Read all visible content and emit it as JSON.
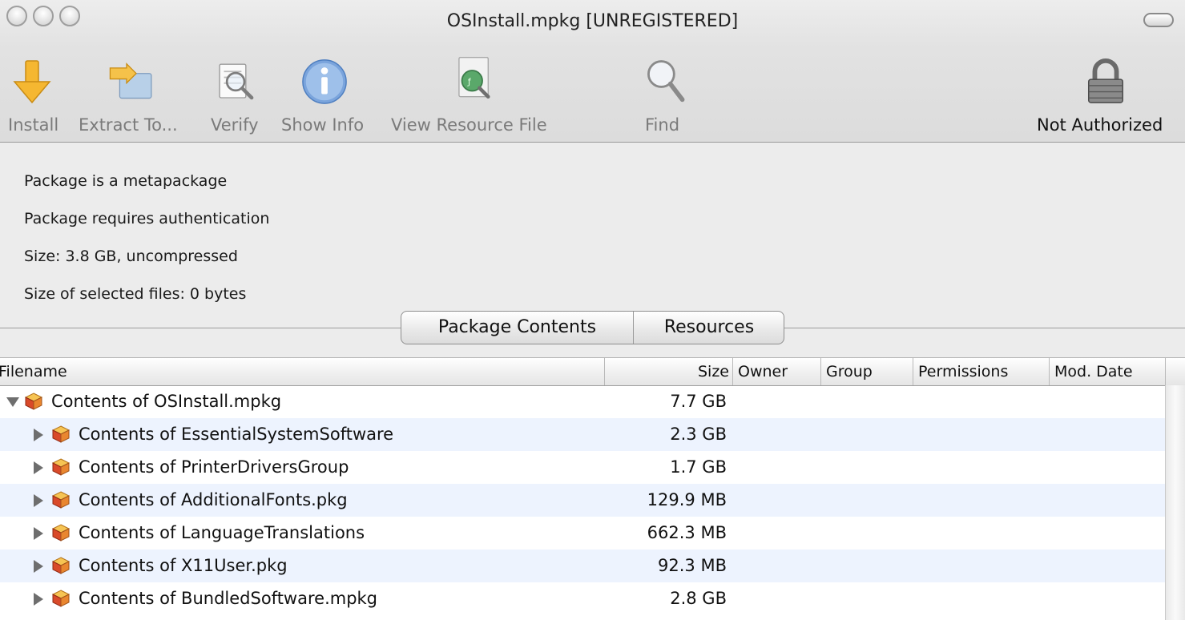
{
  "window": {
    "title": "OSInstall.mpkg [UNREGISTERED]"
  },
  "toolbar": {
    "install": "Install",
    "extract": "Extract To...",
    "verify": "Verify",
    "show_info": "Show Info",
    "view_resource": "View Resource File",
    "find": "Find",
    "auth_status": "Not Authorized"
  },
  "info": {
    "line1": "Package is a metapackage",
    "line2": "Package requires authentication",
    "line3": "Size: 3.8 GB, uncompressed",
    "line4": "Size of selected files: 0 bytes"
  },
  "tabs": {
    "package_contents": "Package Contents",
    "resources": "Resources"
  },
  "table": {
    "columns": {
      "filename": "Filename",
      "size": "Size",
      "owner": "Owner",
      "group": "Group",
      "permissions": "Permissions",
      "mod_date": "Mod. Date"
    },
    "rows": [
      {
        "name": "Contents of OSInstall.mpkg",
        "size": "7.7 GB",
        "expanded": true
      },
      {
        "name": "Contents of EssentialSystemSoftware",
        "size": "2.3 GB",
        "expanded": false
      },
      {
        "name": "Contents of PrinterDriversGroup",
        "size": "1.7 GB",
        "expanded": false
      },
      {
        "name": "Contents of AdditionalFonts.pkg",
        "size": "129.9 MB",
        "expanded": false
      },
      {
        "name": "Contents of LanguageTranslations",
        "size": "662.3 MB",
        "expanded": false
      },
      {
        "name": "Contents of X11User.pkg",
        "size": "92.3 MB",
        "expanded": false
      },
      {
        "name": "Contents of BundledSoftware.mpkg",
        "size": "2.8 GB",
        "expanded": false
      }
    ]
  },
  "colors": {
    "row_alt": "#edf3fe",
    "install_arrow": "#f5b731",
    "info_blue": "#7aa4dc"
  }
}
